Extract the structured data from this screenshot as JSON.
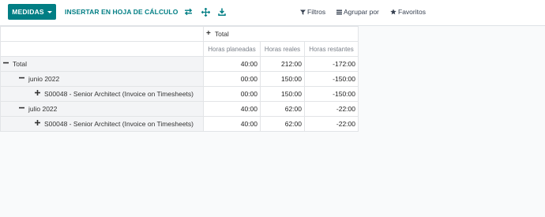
{
  "toolbar": {
    "measures_label": "MEDIDAS",
    "insert_label": "INSERTAR EN HOJA DE CÁLCULO",
    "icons": [
      "flip-axis-icon",
      "expand-all-icon",
      "download-icon"
    ]
  },
  "search": {
    "filters_label": "Filtros",
    "group_by_label": "Agrupar por",
    "favorites_label": "Favoritos"
  },
  "pivot": {
    "column_header": "Total",
    "measures": [
      "Horas planeadas",
      "Horas reales",
      "Horas restantes"
    ],
    "rows": [
      {
        "label": "Total",
        "level": 0,
        "state": "expanded",
        "values": [
          "40:00",
          "212:00",
          "-172:00"
        ]
      },
      {
        "label": "junio 2022",
        "level": 1,
        "state": "expanded",
        "values": [
          "00:00",
          "150:00",
          "-150:00"
        ]
      },
      {
        "label": "S00048 - Senior Architect (Invoice on Timesheets)",
        "level": 2,
        "state": "collapsed",
        "values": [
          "00:00",
          "150:00",
          "-150:00"
        ]
      },
      {
        "label": "julio 2022",
        "level": 1,
        "state": "expanded",
        "values": [
          "40:00",
          "62:00",
          "-22:00"
        ]
      },
      {
        "label": "S00048 - Senior Architect (Invoice on Timesheets)",
        "level": 2,
        "state": "collapsed",
        "values": [
          "40:00",
          "62:00",
          "-22:00"
        ]
      }
    ]
  },
  "colors": {
    "primary": "#017e84",
    "row_header_bg": "#f3f4f6",
    "border": "#e2e4e7"
  }
}
